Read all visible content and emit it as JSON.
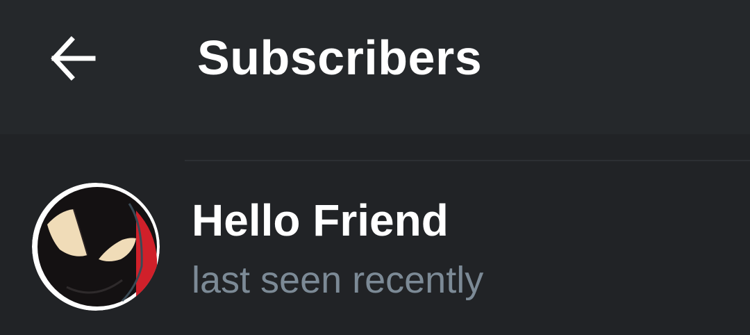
{
  "header": {
    "title": "Subscribers",
    "back_icon": "arrow-left-icon"
  },
  "subscribers": [
    {
      "name": "Hello Friend",
      "status": "last seen recently",
      "avatar_icon": "masked-hero-avatar"
    }
  ],
  "colors": {
    "header_bg": "#25282b",
    "list_bg": "#212326",
    "primary_text": "#ffffff",
    "secondary_text": "#7c8a96",
    "divider": "#2c2f33",
    "avatar_red": "#d0202a"
  }
}
